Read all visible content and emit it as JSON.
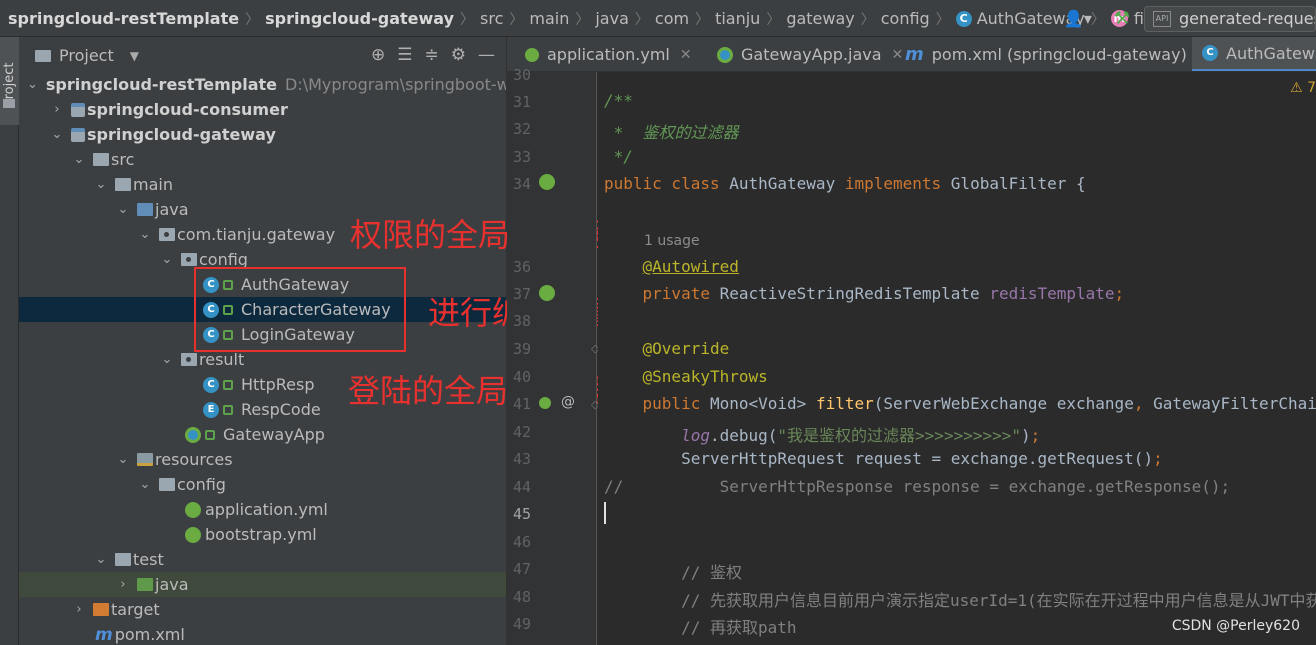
{
  "breadcrumb": [
    "springcloud-restTemplate",
    "springcloud-gateway",
    "src",
    "main",
    "java",
    "com",
    "tianju",
    "gateway",
    "config",
    "AuthGateway",
    "filter"
  ],
  "run_config": "generated-requests",
  "project_panel": {
    "title": "Project"
  },
  "tree": [
    {
      "label": "springcloud-restTemplate",
      "path": "D:\\Myprogram\\springboot-wor"
    },
    {
      "label": "springcloud-consumer"
    },
    {
      "label": "springcloud-gateway"
    },
    {
      "label": "src"
    },
    {
      "label": "main"
    },
    {
      "label": "java"
    },
    {
      "label": "com.tianju.gateway"
    },
    {
      "label": "config"
    },
    {
      "label": "AuthGateway"
    },
    {
      "label": "CharacterGateway"
    },
    {
      "label": "LoginGateway"
    },
    {
      "label": "result"
    },
    {
      "label": "HttpResp"
    },
    {
      "label": "RespCode"
    },
    {
      "label": "GatewayApp"
    },
    {
      "label": "resources"
    },
    {
      "label": "config"
    },
    {
      "label": "application.yml"
    },
    {
      "label": "bootstrap.yml"
    },
    {
      "label": "test"
    },
    {
      "label": "java"
    },
    {
      "label": "target"
    },
    {
      "label": "pom.xml"
    }
  ],
  "annotations": [
    "权限的全局过滤器",
    "进行编码设置",
    "登陆的全局过滤器"
  ],
  "tabs": [
    "application.yml",
    "GatewayApp.java",
    "pom.xml (springcloud-gateway)",
    "AuthGatewa"
  ],
  "editor": {
    "warning": "7",
    "usage": "1 usage",
    "lines": {
      "l30": "30",
      "l31": "31",
      "l32": "32",
      "l33": "33",
      "l34": "34",
      "l36": "36",
      "l37": "37",
      "l38": "38",
      "l39": "39",
      "l40": "40",
      "l41": "41",
      "l42": "42",
      "l43": "43",
      "l44": "44",
      "l45": "45",
      "l46": "46",
      "l47": "47",
      "l48": "48",
      "l49": "49"
    }
  },
  "watermark": "CSDN @Perley620",
  "colors": {
    "accent": "#4a88c7",
    "annotation": "#e8312f",
    "selection": "#0d293e"
  }
}
